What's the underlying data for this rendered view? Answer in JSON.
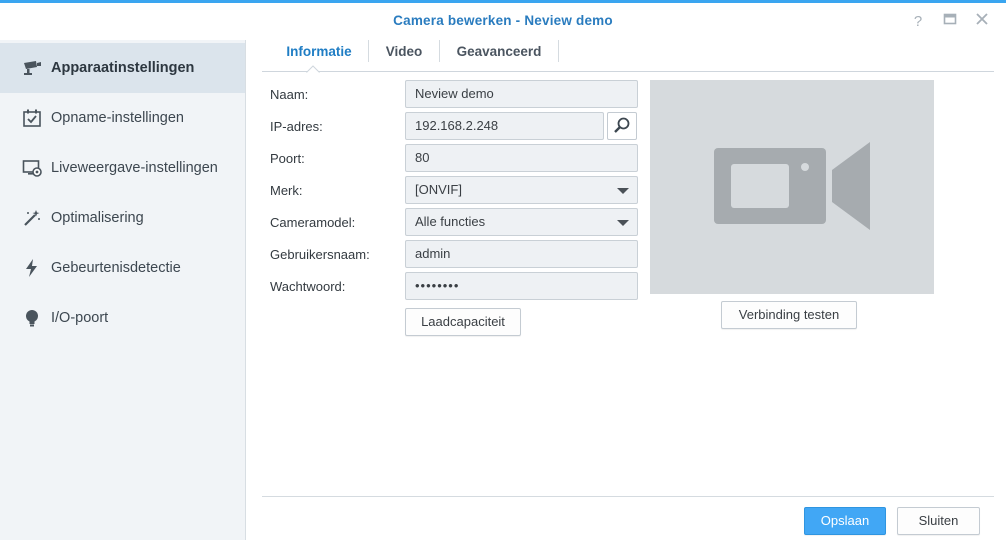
{
  "window": {
    "title": "Camera bewerken - Neview demo",
    "help_glyph": "?",
    "accent_color": "#3aa5f0"
  },
  "sidebar": {
    "items": [
      {
        "label": "Apparaatinstellingen",
        "icon": "camera-icon",
        "active": true
      },
      {
        "label": "Opname-instellingen",
        "icon": "calendar-check-icon",
        "active": false
      },
      {
        "label": "Liveweergave-instellingen",
        "icon": "monitor-gear-icon",
        "active": false
      },
      {
        "label": "Optimalisering",
        "icon": "magic-wand-icon",
        "active": false
      },
      {
        "label": "Gebeurtenisdetectie",
        "icon": "lightning-icon",
        "active": false
      },
      {
        "label": "I/O-poort",
        "icon": "lightbulb-icon",
        "active": false
      }
    ]
  },
  "tabs": [
    {
      "label": "Informatie",
      "active": true
    },
    {
      "label": "Video",
      "active": false
    },
    {
      "label": "Geavanceerd",
      "active": false
    }
  ],
  "form": {
    "name": {
      "label": "Naam:",
      "value": "Neview demo"
    },
    "ip": {
      "label": "IP-adres:",
      "value": "192.168.2.248"
    },
    "port": {
      "label": "Poort:",
      "value": "80"
    },
    "brand": {
      "label": "Merk:",
      "value": "[ONVIF]"
    },
    "model": {
      "label": "Cameramodel:",
      "value": "Alle functies"
    },
    "username": {
      "label": "Gebruikersnaam:",
      "value": "admin"
    },
    "password": {
      "label": "Wachtwoord:",
      "value": "••••••••"
    }
  },
  "buttons": {
    "capacity": "Laadcapaciteit",
    "test_connection": "Verbinding testen",
    "save": "Opslaan",
    "close": "Sluiten"
  }
}
